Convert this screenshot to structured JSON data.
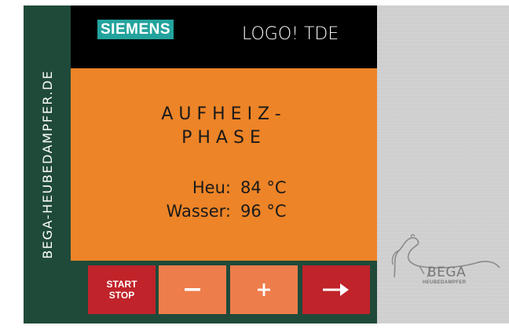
{
  "side_text": "BEGA-HEUBEDAMPFER.DE",
  "header": {
    "brand": "SIEMENS",
    "model": "LOGO! TDE"
  },
  "status": {
    "phase_line1": "AUFHEIZ-",
    "phase_line2": "PHASE",
    "readings": [
      {
        "label": "Heu:",
        "value": "84 °C"
      },
      {
        "label": "Wasser:",
        "value": "96 °C"
      }
    ]
  },
  "buttons": {
    "start_line1": "START",
    "start_line2": "STOP",
    "minus": "–",
    "plus": "+",
    "next": "→"
  },
  "logo": {
    "word": "BEGA",
    "sub": "HEUBEDAMPFER"
  },
  "colors": {
    "panel": "#ed8427",
    "frame": "#1f4a39",
    "accent_red": "#c0232a",
    "button_orange": "#ee7d4c",
    "brand_teal": "#23a39d"
  }
}
